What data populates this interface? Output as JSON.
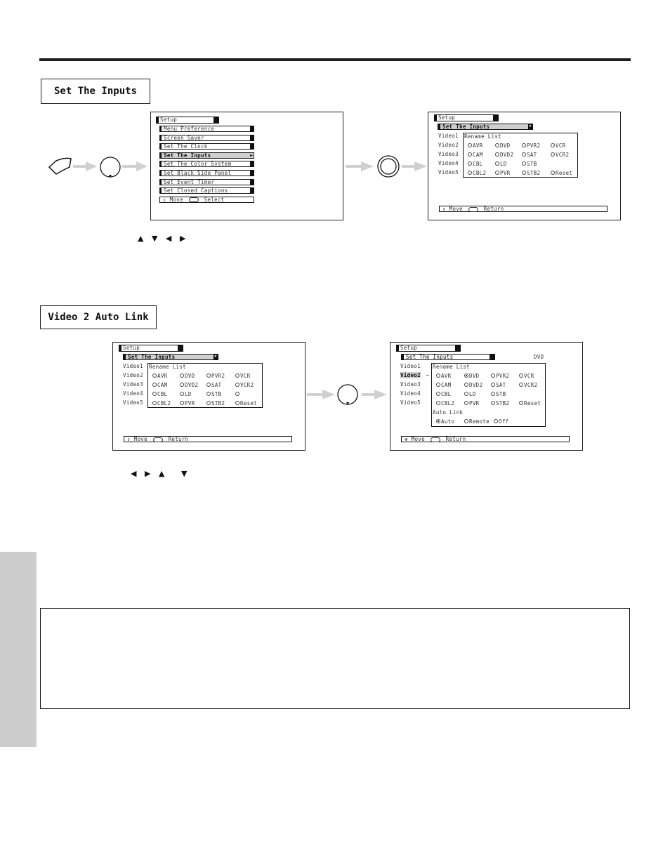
{
  "sections": {
    "set_inputs_title": "Set The Inputs",
    "auto_link_title": "Video 2 Auto Link"
  },
  "setup_menu": {
    "header": "Setup",
    "items": [
      {
        "label": "Menu Preference",
        "selected": false
      },
      {
        "label": "Screen Saver",
        "selected": false
      },
      {
        "label": "Set The Clock",
        "selected": false
      },
      {
        "label": "Set The Inputs",
        "selected": true
      },
      {
        "label": "Set The Color System",
        "selected": false
      },
      {
        "label": "Set Black Side Panel",
        "selected": false
      },
      {
        "label": "Set Event Timer",
        "selected": false
      },
      {
        "label": "Set Closed Captions",
        "selected": false
      }
    ],
    "status": {
      "move": "Move",
      "action": "Select"
    }
  },
  "inputs_screen": {
    "header": "Setup",
    "submenu": "Set The Inputs",
    "videos": [
      "Video1",
      "Video2",
      "Video3",
      "Video4",
      "Video5"
    ],
    "rename_list_label": "Rename List",
    "options": [
      [
        "AVR",
        "DVD",
        "PVR2",
        "VCR"
      ],
      [
        "CAM",
        "DVD2",
        "SAT",
        "VCR2"
      ],
      [
        "CBL",
        "LD",
        "STB",
        ""
      ],
      [
        "CBL2",
        "PVR",
        "STB2",
        "Reset"
      ]
    ],
    "status": {
      "move": "Move",
      "action": "Return"
    }
  },
  "auto_link_screen_before": {
    "header": "Setup",
    "submenu": "Set The Inputs",
    "videos": [
      "Video1",
      "Video2",
      "Video3",
      "Video4",
      "Video5"
    ],
    "rename_list_label": "Rename List",
    "options": [
      [
        "AVR",
        "DVD",
        "PVR2",
        "VCR"
      ],
      [
        "CAM",
        "DVD2",
        "SAT",
        "VCR2"
      ],
      [
        "CBL",
        "LD",
        "STB",
        ""
      ],
      [
        "CBL2",
        "PVR",
        "STB2",
        "Reset"
      ]
    ],
    "status": {
      "move": "Move",
      "action": "Return"
    }
  },
  "auto_link_screen_after": {
    "header": "Setup",
    "submenu": "Set The Inputs",
    "current_name": "DVD",
    "videos": [
      "Video1",
      "Video2",
      "Video3",
      "Video4",
      "Video5"
    ],
    "selected_video": "Video2",
    "pointer": "→",
    "rename_list_label": "Rename List",
    "options": [
      [
        "AVR",
        "DVD",
        "PVR2",
        "VCR"
      ],
      [
        "CAM",
        "DVD2",
        "SAT",
        "VCR2"
      ],
      [
        "CBL",
        "LD",
        "STB",
        ""
      ],
      [
        "CBL2",
        "PVR",
        "STB2",
        "Reset"
      ]
    ],
    "selected_option": "DVD",
    "auto_link_label": "Auto Link",
    "auto_link_options": [
      "Auto",
      "Remote",
      "Off"
    ],
    "auto_link_selected": "Auto",
    "status": {
      "move": "Move",
      "action": "Return"
    }
  },
  "nav_hints": {
    "set_inputs": "▲ ▼ ◀ ▶",
    "auto_link_lr": "◀ ▶ ▲",
    "auto_link_down": "▼"
  },
  "colors": {
    "rule": "#231f20",
    "highlight": "#cfcfcf",
    "flow_arrow": "#d0d0d0",
    "side_tab": "#cdcdcd"
  }
}
